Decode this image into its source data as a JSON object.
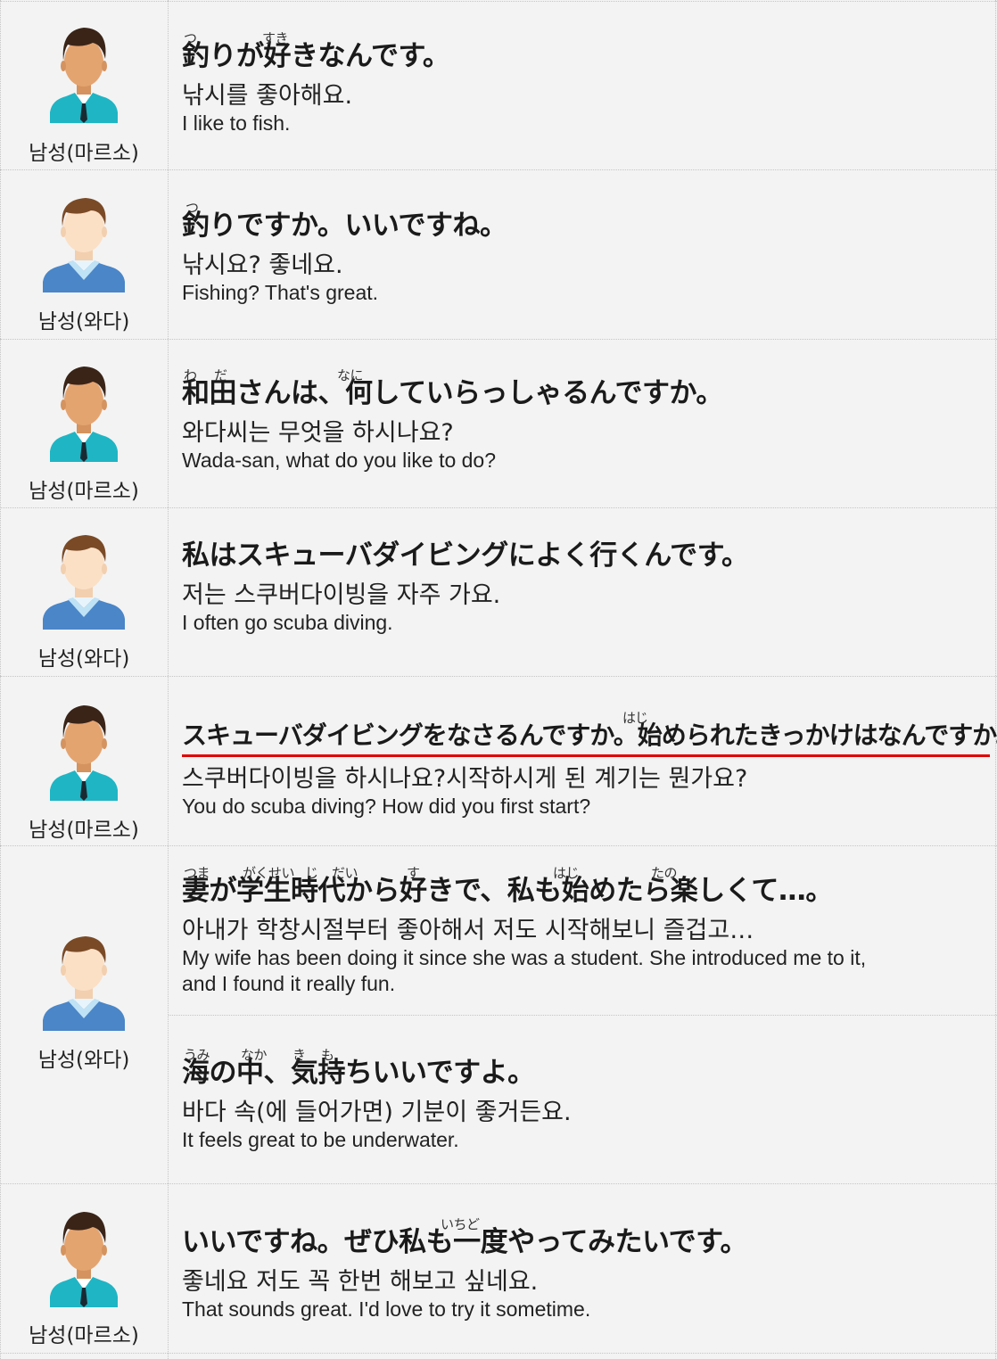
{
  "speakers": {
    "maruso": "남성(마르소)",
    "wada": "남성(와다)"
  },
  "lines": [
    {
      "ja": "釣りが好きなんです。",
      "ko": "낚시를 좋아해요.",
      "en": "I like to fish.",
      "furigana": [
        "つ",
        "すき"
      ]
    },
    {
      "ja": "釣りですか。いいですね。",
      "ko": "낚시요? 좋네요.",
      "en": "Fishing? That's great.",
      "furigana": [
        "つ"
      ]
    },
    {
      "ja": "和田さんは、何していらっしゃるんですか。",
      "ko": "와다씨는 무엇을 하시나요?",
      "en": "Wada-san, what do you like to do?",
      "furigana": [
        "わ",
        "だ",
        "なに"
      ]
    },
    {
      "ja": "私はスキューバダイビングによく行くんです。",
      "ko": "저는 스쿠버다이빙을 자주 가요.",
      "en": "I often go scuba diving."
    },
    {
      "ja": "スキューバダイビングをなさるんですか。始められたきっかけはなんですか。",
      "ko": "스쿠버다이빙을 하시나요?시작하시게 된 계기는 뭔가요?",
      "en": "You do scuba diving? How did you first start?",
      "furigana": [
        "はじ"
      ]
    },
    {
      "ja": "妻が学生時代から好きで、私も始めたら楽しくて…。",
      "ko": "아내가 학창시절부터 좋아해서 저도 시작해보니 즐겁고…",
      "en": "My wife has been doing it since she was a student. She introduced me to it,",
      "en2": "and I found it really fun.",
      "furigana": [
        "つま",
        "がくせい",
        "じ",
        "だい",
        "す",
        "はじ",
        "たの"
      ]
    },
    {
      "ja": "海の中、気持ちいいですよ。",
      "ko": "바다 속(에 들어가면) 기분이 좋거든요.",
      "en": "It feels great to be underwater.",
      "furigana": [
        "うみ",
        "なか",
        "き",
        "も"
      ]
    },
    {
      "ja": "いいですね。ぜひ私も一度やってみたいです。",
      "ko": "좋네요 저도 꼭 한번 해보고 싶네요.",
      "en": "That sounds great. I'd love to try it sometime.",
      "furigana": [
        "いちど"
      ]
    }
  ],
  "colors": {
    "underline": "#e00000",
    "maruso_shirt": "#1fb5c4",
    "wada_vest": "#4a86c8"
  },
  "icons": {
    "maruso": "man-avatar-tie-icon",
    "wada": "man-avatar-vest-icon"
  }
}
